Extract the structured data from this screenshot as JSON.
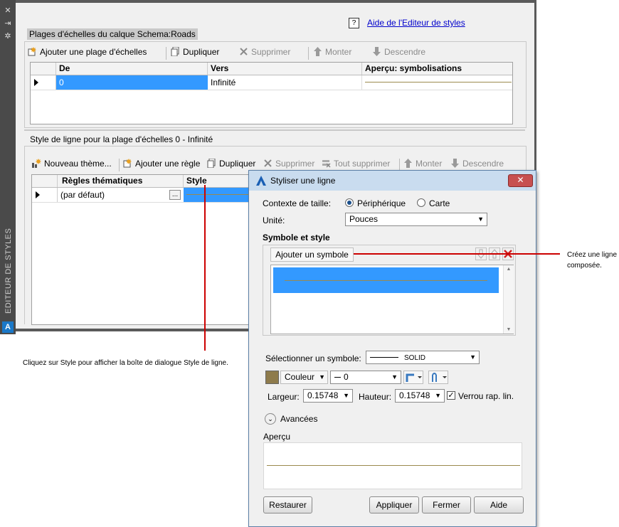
{
  "sidebar": {
    "title": "EDITEUR DE STYLES",
    "icons": [
      "close-icon",
      "pin-icon",
      "settings-icon"
    ]
  },
  "header": {
    "help_link": "Aide de l'Editeur de styles"
  },
  "scale_ranges": {
    "title": "Plages d'échelles du calque Schema:Roads",
    "toolbar": {
      "add": "Ajouter une plage d'échelles",
      "duplicate": "Dupliquer",
      "delete": "Supprimer",
      "up": "Monter",
      "down": "Descendre"
    },
    "columns": [
      "De",
      "Vers",
      "Aperçu: symbolisations"
    ],
    "rows": [
      {
        "from": "0",
        "to": "Infinité"
      }
    ]
  },
  "line_style": {
    "title": "Style de ligne pour la plage d'échelles 0 - Infinité",
    "toolbar": {
      "new_theme": "Nouveau thème...",
      "add_rule": "Ajouter une règle",
      "duplicate": "Dupliquer",
      "delete": "Supprimer",
      "delete_all": "Tout supprimer",
      "up": "Monter",
      "down": "Descendre"
    },
    "columns": [
      "Règles thématiques",
      "Style"
    ],
    "rows": [
      {
        "rule": "(par défaut)",
        "ellipsis": "..."
      }
    ]
  },
  "dialog": {
    "title": "Styliser une ligne",
    "close": "✕",
    "size_context_label": "Contexte de taille:",
    "size_options": [
      "Périphérique",
      "Carte"
    ],
    "size_selected": "Périphérique",
    "unit_label": "Unité:",
    "unit_value": "Pouces",
    "symbol_section": "Symbole et style",
    "add_symbol": "Ajouter un symbole",
    "select_symbol_label": "Sélectionner un symbole:",
    "symbol_value": "SOLID",
    "color_value": "Couleur",
    "lineweight_value": "0",
    "width_label": "Largeur:",
    "width_value": "0.15748",
    "height_label": "Hauteur:",
    "height_value": "0.15748",
    "lock_ratio": "Verrou rap. lin.",
    "advanced": "Avancées",
    "preview_label": "Aperçu",
    "buttons": {
      "restore": "Restaurer",
      "apply": "Appliquer",
      "close": "Fermer",
      "help": "Aide"
    }
  },
  "annotations": {
    "right": [
      "Créez une ligne",
      "composée."
    ],
    "bottom": "Cliquez sur Style pour afficher la boîte de dialogue Style de ligne."
  },
  "colors": {
    "selection_blue": "#3399ff",
    "line_color": "#9b8a4e",
    "swatch": "#8e7b4c",
    "annotation_red": "#cc0000"
  }
}
